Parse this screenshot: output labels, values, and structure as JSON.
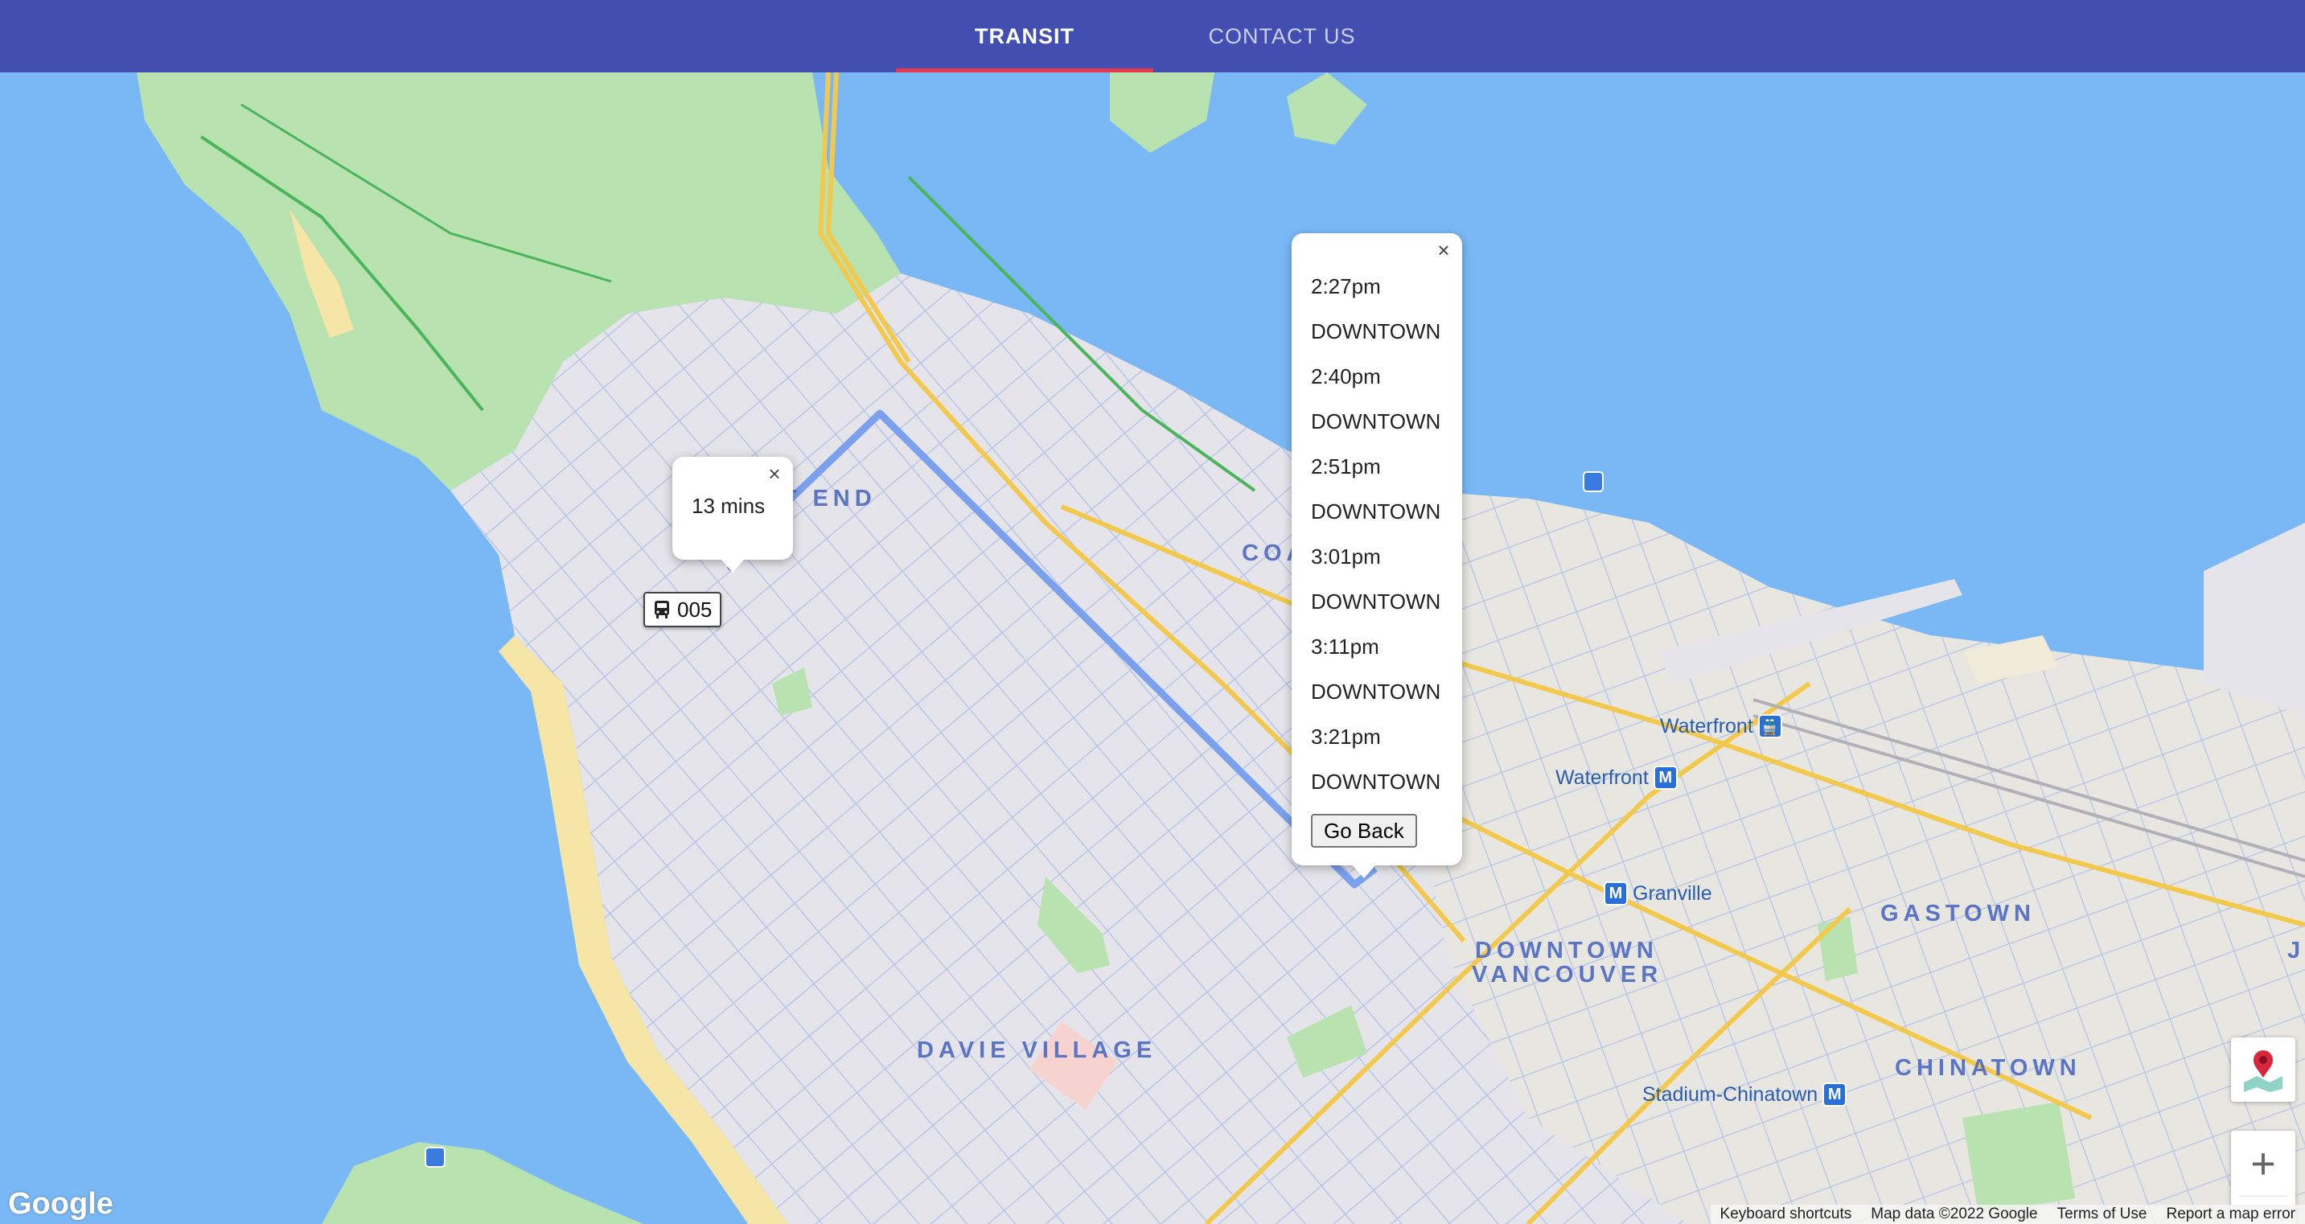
{
  "nav": {
    "tabs": [
      {
        "label": "TRANSIT",
        "active": true
      },
      {
        "label": "CONTACT US",
        "active": false
      }
    ],
    "accent": "#e8384f",
    "bar_color": "#434fb0"
  },
  "map": {
    "area_labels": {
      "west_end": "EST END",
      "coal_harbour": "COA      UR",
      "downtown_1": "DOWNTOWN",
      "downtown_2": "VANCOUVER",
      "gastown": "GASTOWN",
      "chinatown": "CHINATOWN",
      "davie": "DAVIE VILLAGE",
      "j": "J"
    },
    "stations": {
      "waterfront_train": "Waterfront",
      "waterfront_metro": "Waterfront",
      "granville": "Granville",
      "stadium": "Stadium-Chinatown"
    },
    "metro_badge": "M",
    "route_color": "#7aa0ee",
    "water_color": "#7ab8f5",
    "park_color": "#b8e2b0"
  },
  "eta_popup": {
    "text": "13 mins",
    "close_icon": "close-icon"
  },
  "bus_marker": {
    "route": "005",
    "icon": "bus-icon"
  },
  "schedule_popup": {
    "entries": [
      {
        "time": "2:27pm",
        "destination": "DOWNTOWN"
      },
      {
        "time": "2:40pm",
        "destination": "DOWNTOWN"
      },
      {
        "time": "2:51pm",
        "destination": "DOWNTOWN"
      },
      {
        "time": "3:01pm",
        "destination": "DOWNTOWN"
      },
      {
        "time": "3:11pm",
        "destination": "DOWNTOWN"
      },
      {
        "time": "3:21pm",
        "destination": "DOWNTOWN"
      }
    ],
    "button_label": "Go Back",
    "close_icon": "close-icon"
  },
  "controls": {
    "zoom_in": "+",
    "zoom_out": "−"
  },
  "footer": {
    "logo": "Google",
    "links": [
      "Keyboard shortcuts",
      "Map data ©2022 Google",
      "Terms of Use",
      "Report a map error"
    ]
  }
}
